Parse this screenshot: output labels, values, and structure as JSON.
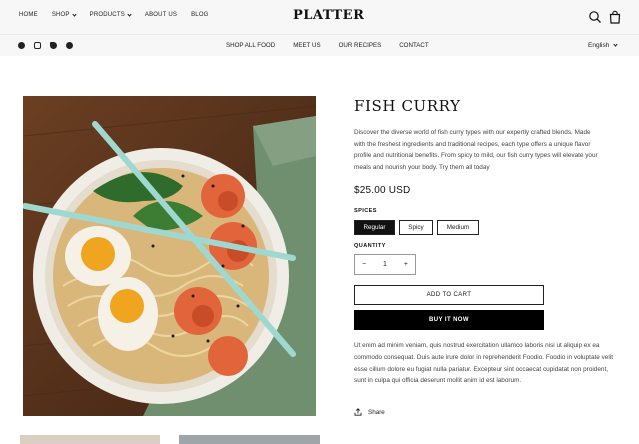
{
  "header": {
    "nav_left": [
      {
        "label": "HOME",
        "dropdown": false
      },
      {
        "label": "SHOP",
        "dropdown": true
      },
      {
        "label": "PRODUCTS",
        "dropdown": true
      },
      {
        "label": "ABOUT US",
        "dropdown": false
      },
      {
        "label": "BLOG",
        "dropdown": false
      }
    ],
    "logo": "PLATTER",
    "icons": [
      "search-icon",
      "shopping-bag-icon"
    ]
  },
  "subbar": {
    "social_icons": [
      "facebook-icon",
      "instagram-icon",
      "twitter-icon",
      "pinterest-icon"
    ],
    "nav_center": [
      "SHOP ALL FOOD",
      "MEET US",
      "OUR RECIPES",
      "CONTACT"
    ],
    "language": "English"
  },
  "product": {
    "title": "FISH CURRY",
    "description": "Discover the diverse world of fish curry types with our expertly crafted blends. Made with the freshest ingredients and traditional recipes, each type offers a unique flavor profile and nutritional benefits. From spicy to mild, our fish curry types will elevate your meals and nourish your body. Try them all today",
    "price": "$25.00 USD",
    "spices_label": "SPICES",
    "spice_options": [
      "Regular",
      "Spicy",
      "Medium"
    ],
    "selected_spice": "Regular",
    "quantity_label": "QUANTITY",
    "quantity_value": "1",
    "minus_symbol": "−",
    "plus_symbol": "+",
    "add_to_cart": "ADD TO CART",
    "buy_now": "BUY IT NOW",
    "body_text": "Ut enim ad minim veniam, quis nostrud exercitation ullamco laboris nisi ut aliquip ex ea commodo consequat. Duis aute irure dolor in reprehenderit Foodio. Foodio in voluptate velit esse cillum dolore eu fugiat nulla pariatur. Excepteur sint occaecat cupidatat non proident, sunt in culpa qui officia deserunt mollit anim id est laborum.",
    "share": "Share"
  },
  "colors": {
    "background": "#ffffff",
    "header_bg": "#f7f7f7",
    "button_primary": "#000000",
    "text": "#1a1a1a"
  }
}
